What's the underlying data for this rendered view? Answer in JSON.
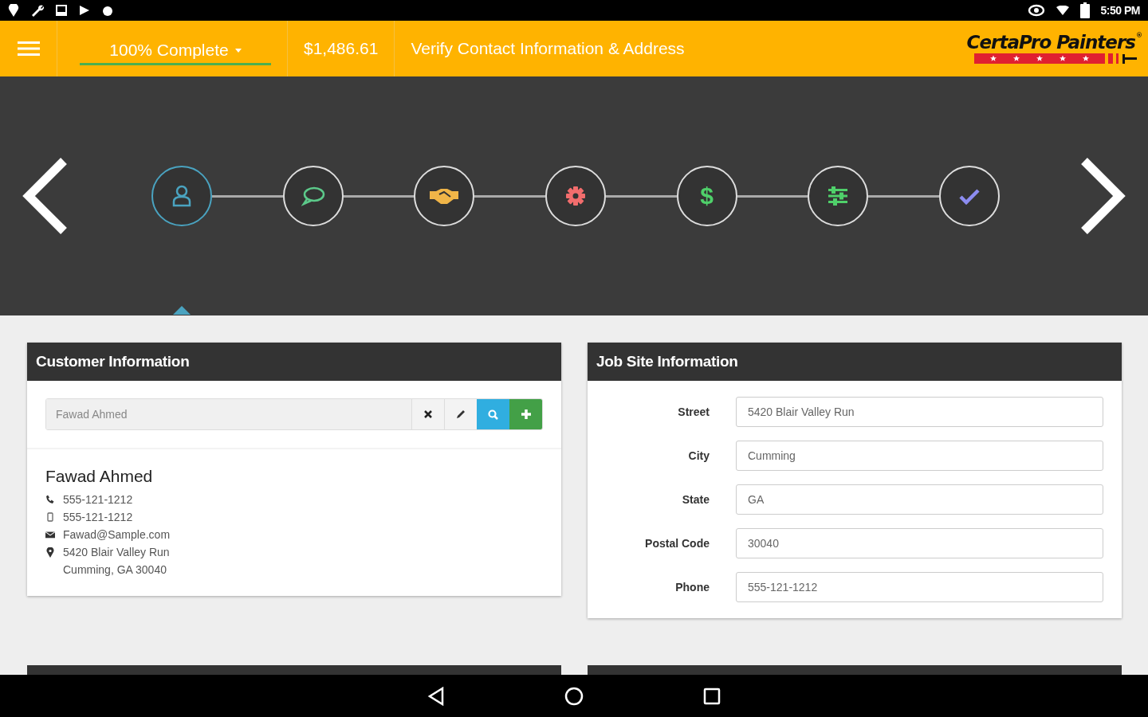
{
  "status_bar": {
    "time": "5:50 PM"
  },
  "header": {
    "progress": {
      "label": "100% Complete",
      "level": 1
    },
    "price": "$1,486.61",
    "title": "Verify Contact Information & Address",
    "logo": {
      "text": "CertaPro Painters",
      "mark": "®"
    }
  },
  "steps": [
    {
      "kind": "person",
      "color": "#4aa3c0",
      "selected": true
    },
    {
      "kind": "chat",
      "color": "#5cc98a",
      "selected": false
    },
    {
      "kind": "handshake",
      "color": "#f0b548",
      "selected": false
    },
    {
      "kind": "gear",
      "color": "#f26d6d",
      "selected": false
    },
    {
      "kind": "text",
      "text": "$",
      "color": "#4fd06a",
      "selected": false
    },
    {
      "kind": "sliders",
      "color": "#4fd06a",
      "selected": false
    },
    {
      "kind": "check",
      "color": "#8c8cf0",
      "selected": false
    }
  ],
  "customer": {
    "title": "Customer Information",
    "search": {
      "value": "Fawad Ahmed"
    },
    "name": "Fawad Ahmed",
    "details": [
      {
        "kind": "phone",
        "text": "555-121-1212"
      },
      {
        "kind": "mobile",
        "text": "555-121-1212"
      },
      {
        "kind": "email",
        "text": "Fawad@Sample.com"
      },
      {
        "kind": "address",
        "lines": [
          "5420 Blair Valley Run",
          "Cumming, GA 30040"
        ]
      }
    ]
  },
  "job_site": {
    "title": "Job Site Information",
    "fields": [
      {
        "label": "Street",
        "value": "5420 Blair Valley Run"
      },
      {
        "label": "City",
        "value": "Cumming"
      },
      {
        "label": "State",
        "value": "GA"
      },
      {
        "label": "Postal Code",
        "value": "30040"
      },
      {
        "label": "Phone",
        "value": "555-121-1212"
      }
    ]
  }
}
